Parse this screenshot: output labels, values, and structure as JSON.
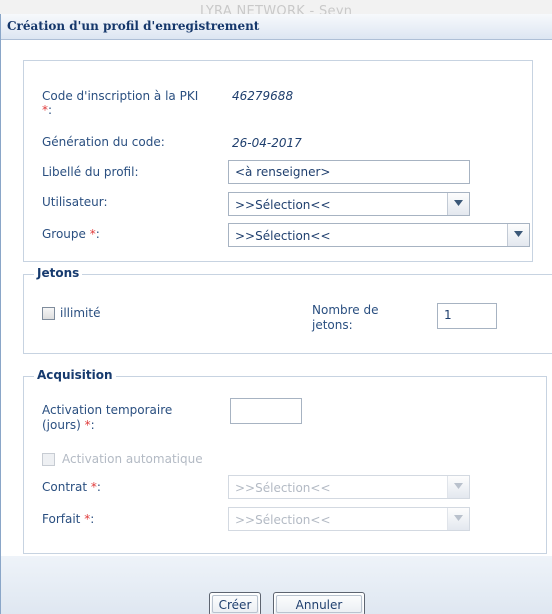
{
  "background": {
    "text": "LYRA NETWORK - Seyn"
  },
  "dialog": {
    "title": "Création d'un profil d'enregistrement"
  },
  "main": {
    "code_label": "Code d'inscription à la PKI",
    "code_value": "46279688",
    "generation_label": "Génération du code:",
    "generation_value": "26-04-2017",
    "libelle_label": "Libellé du profil:",
    "libelle_value": "<à renseigner>",
    "utilisateur_label": "Utilisateur:",
    "utilisateur_value": ">>Sélection<<",
    "groupe_label": "Groupe",
    "groupe_value": ">>Sélection<<",
    "required_mark": "*",
    "colon": ":"
  },
  "jetons": {
    "legend": "Jetons",
    "illimite_label": "illimité",
    "nombre_label_line1": "Nombre de",
    "nombre_label_line2": "jetons:",
    "nombre_value": "1"
  },
  "acquisition": {
    "legend": "Acquisition",
    "activation_label_line1": "Activation temporaire",
    "activation_label_line2": "(jours)",
    "activation_value": "",
    "auto_label": "Activation automatique",
    "contrat_label": "Contrat",
    "contrat_value": ">>Sélection<<",
    "forfait_label": "Forfait",
    "forfait_value": ">>Sélection<<"
  },
  "footer": {
    "create_label": "Créer",
    "cancel_label": "Annuler"
  }
}
